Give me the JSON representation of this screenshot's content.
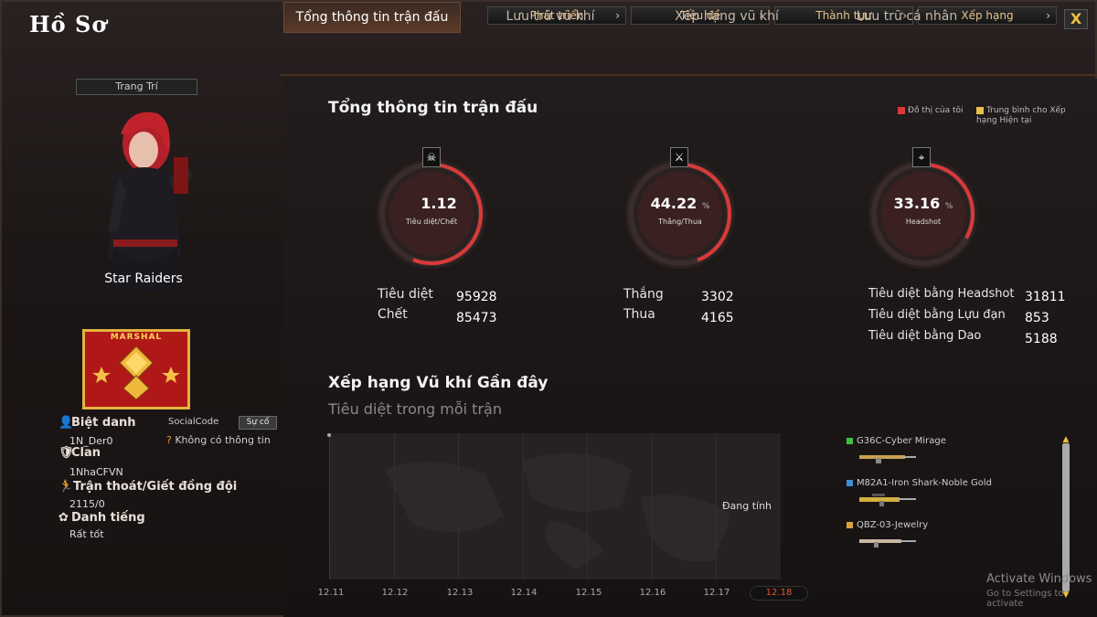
{
  "window": {
    "title": "Hồ Sơ",
    "close_label": "X"
  },
  "topnav": [
    {
      "label": "Phát triển"
    },
    {
      "label": "Tiêu đề"
    },
    {
      "label": "Thành tựu"
    },
    {
      "label": "Xếp hạng"
    }
  ],
  "tabs": [
    {
      "label": "Tổng thông tin trận đấu",
      "active": true
    },
    {
      "label": "Lưu trữ vũ khí"
    },
    {
      "label": "Xếp hạng vũ khí"
    },
    {
      "label": "Lưu trữ cá nhân"
    }
  ],
  "profile": {
    "decorate_button": "Trang Trí",
    "character_name": "Star Raiders",
    "rank_badge": "MARSHAL",
    "nickname_label": "Biệt danh",
    "nickname": "1N_Der0",
    "social_label": "SocialCode",
    "social_button": "Sự cố",
    "social_value": "Không có thông tin",
    "clan_label": "Clan",
    "clan": "1NhaCFVN",
    "escape_label": "Trận thoát/Giết đồng đội",
    "escape_value": "2115/0",
    "reputation_label": "Danh tiếng",
    "reputation": "Rất tốt"
  },
  "summary": {
    "heading": "Tổng thông tin trận đấu",
    "legend_mine": "Đồ thị của tôi",
    "legend_avg": "Trung bình cho Xếp hạng Hiện tại",
    "colors": {
      "mine": "#d8383a",
      "avg": "#e8c24a"
    },
    "gauges": [
      {
        "value": "1.12",
        "unit": "",
        "label": "Tiêu diệt/Chết",
        "icon": "skull-icon",
        "fill": 0.56
      },
      {
        "value": "44.22",
        "unit": "%",
        "label": "Thắng/Thua",
        "icon": "crossed-guns-icon",
        "fill": 0.4422
      },
      {
        "value": "33.16",
        "unit": "%",
        "label": "Headshot",
        "icon": "rifle-icon",
        "fill": 0.3316
      }
    ],
    "kills_label": "Tiêu diệt",
    "kills": "95928",
    "deaths_label": "Chết",
    "deaths": "85473",
    "wins_label": "Thắng",
    "wins": "3302",
    "losses_label": "Thua",
    "losses": "4165",
    "hs_kills_label": "Tiêu diệt bằng Headshot",
    "hs_kills": "31811",
    "grenade_kills_label": "Tiêu diệt bằng Lựu đạn",
    "grenade_kills": "853",
    "knife_kills_label": "Tiêu diệt bằng Dao",
    "knife_kills": "5188"
  },
  "recent": {
    "heading": "Xếp hạng Vũ khí Gần đây",
    "subheading": "Tiêu diệt trong mỗi trận",
    "pending": "Đang tính",
    "dates": [
      "12.11",
      "12.12",
      "12.13",
      "12.14",
      "12.15",
      "12.16",
      "12.17",
      "12.18"
    ],
    "selected_date": "12.18",
    "weapons": [
      {
        "name": "G36C-Cyber Mirage",
        "color": "#3fbf3f"
      },
      {
        "name": "M82A1-Iron Shark-Noble Gold",
        "color": "#3f8fd8"
      },
      {
        "name": "QBZ-03-Jewelry",
        "color": "#d8a23f"
      }
    ]
  },
  "system": {
    "activate": "Activate Windows",
    "activate_sub": "Go to Settings to activate"
  }
}
